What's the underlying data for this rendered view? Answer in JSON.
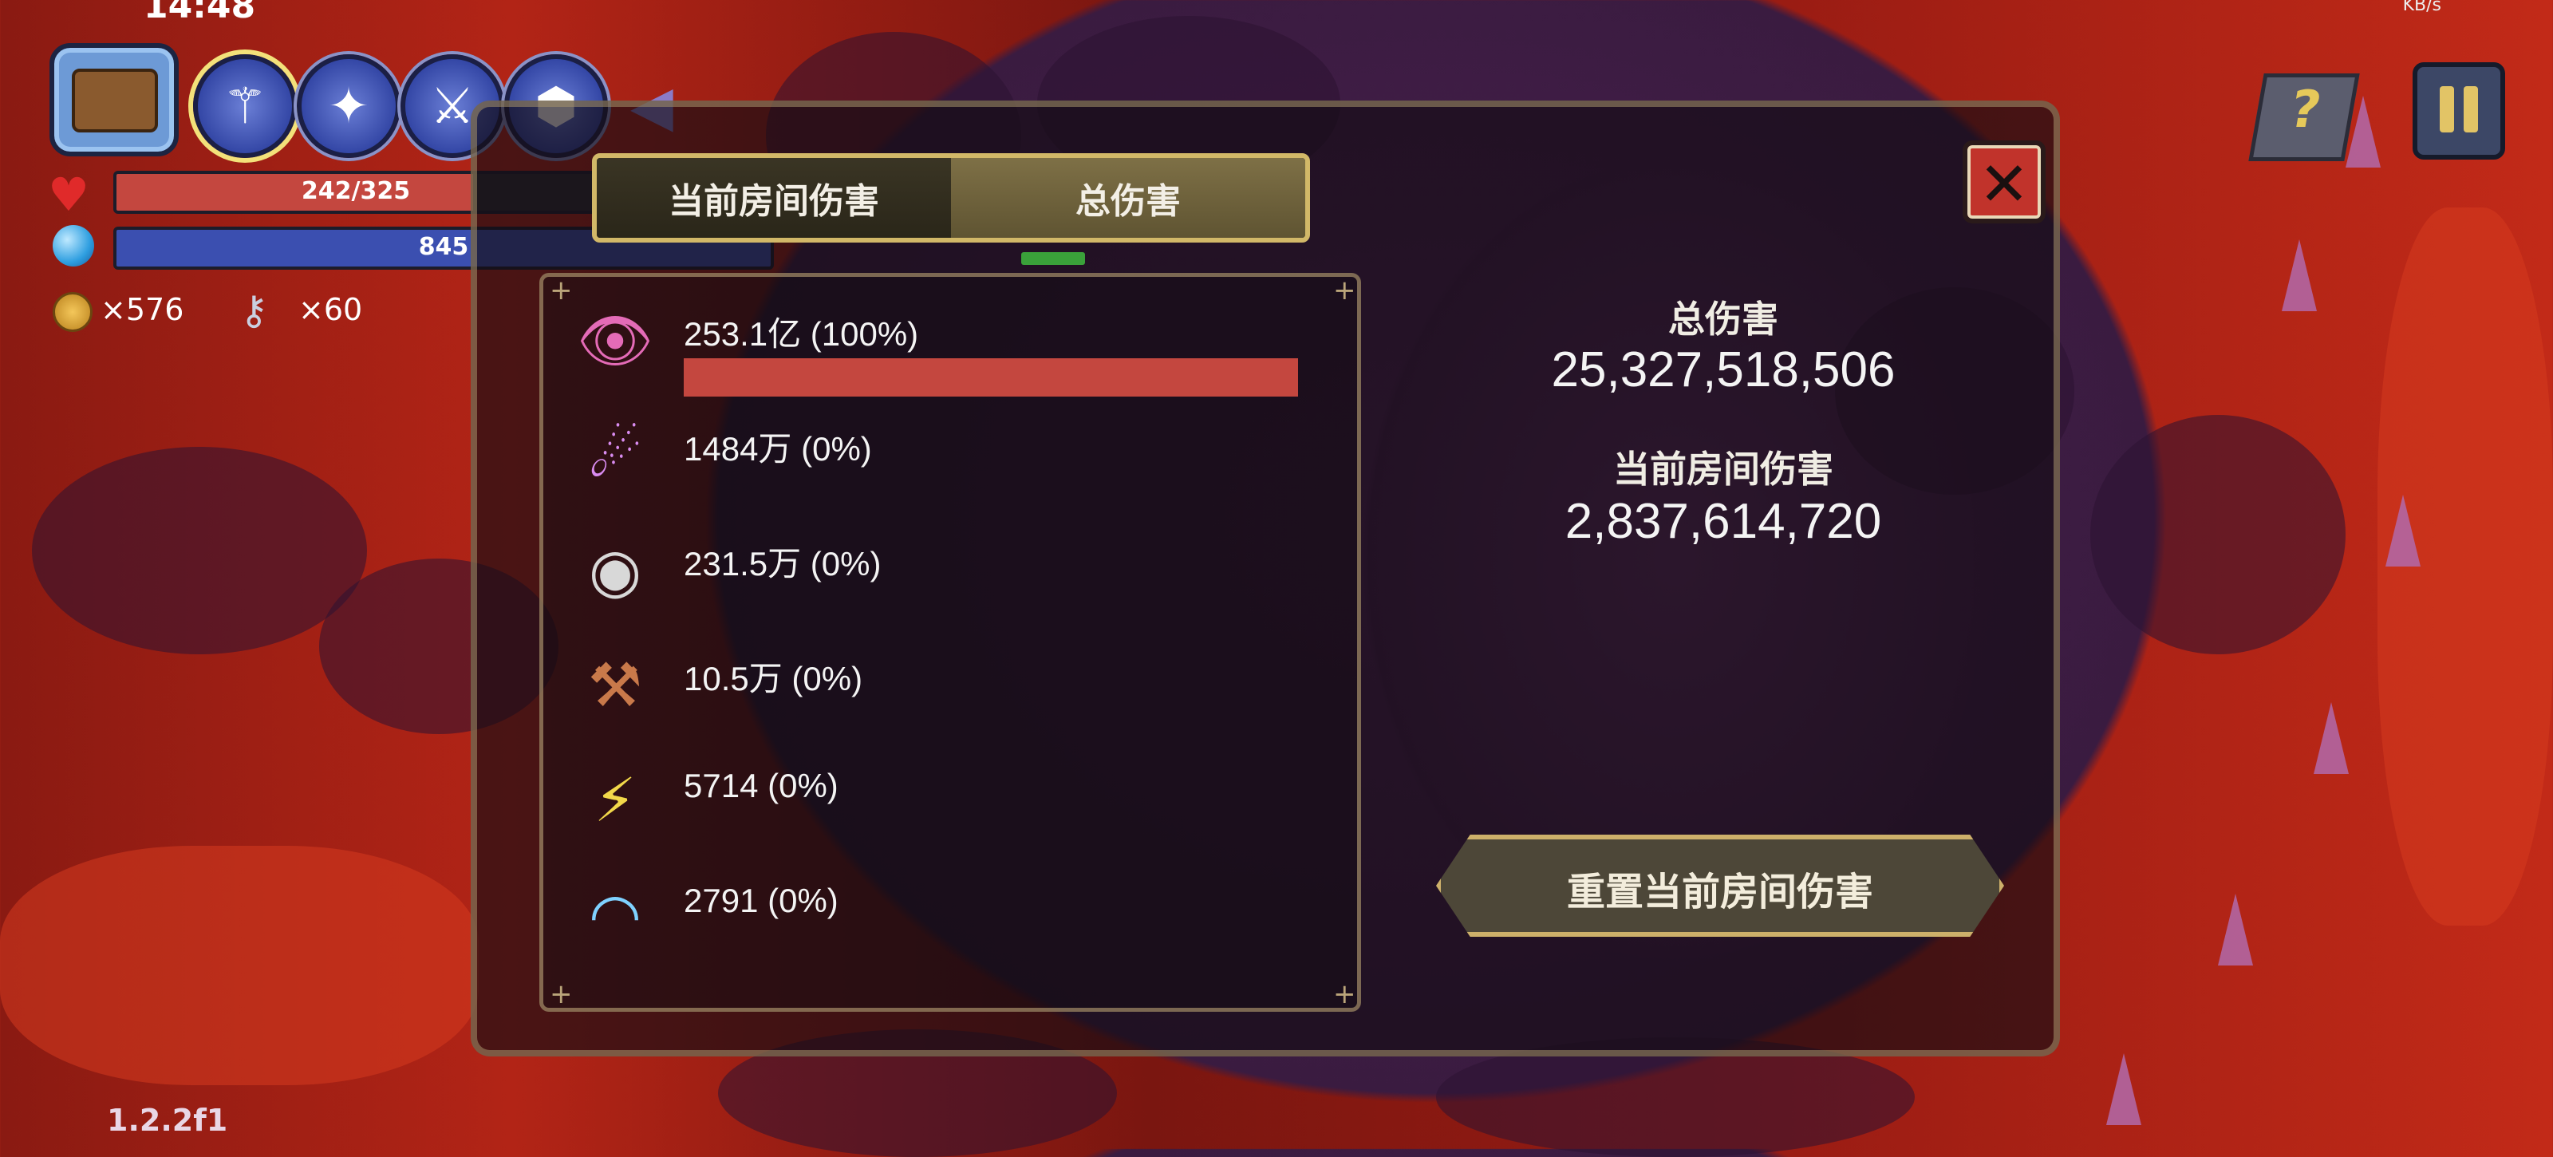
{
  "status_bar": {
    "time": "14:48",
    "network_rate": "KB/s"
  },
  "hud": {
    "hp": {
      "current": 242,
      "max": 325,
      "text": "242/325"
    },
    "mana": {
      "text": "845"
    },
    "coins": "×576",
    "keys": "×60",
    "weapon_slots": [
      "staff-icon",
      "wand-icon",
      "sword-icon",
      "shield-icon"
    ],
    "help_symbol": "?",
    "version": "1.2.2f1"
  },
  "dialog": {
    "tabs": {
      "current_room": "当前房间伤害",
      "total": "总伤害",
      "selected": "total"
    },
    "close_symbol": "✕",
    "damage_list": [
      {
        "icon": "demon-eye-icon",
        "value": "253.1亿 (100%)",
        "share": 1.0
      },
      {
        "icon": "comet-icon",
        "value": "1484万 (0%)",
        "share": 0
      },
      {
        "icon": "eyeball-icon",
        "value": "231.5万 (0%)",
        "share": 0
      },
      {
        "icon": "hammer-icon",
        "value": "10.5万 (0%)",
        "share": 0
      },
      {
        "icon": "lightning-icon",
        "value": "5714 (0%)",
        "share": 0
      },
      {
        "icon": "rainbow-icon",
        "value": "2791 (0%)",
        "share": 0
      }
    ],
    "summary": {
      "total_label": "总伤害",
      "total_value": "25,327,518,506",
      "room_label": "当前房间伤害",
      "room_value": "2,837,614,720"
    },
    "reset_button": "重置当前房间伤害"
  },
  "colors": {
    "hp_bar": "#c4473f",
    "mana_bar": "#3b4fb0",
    "damage_bar": "#c4473f",
    "tab_border": "#d2b868"
  }
}
